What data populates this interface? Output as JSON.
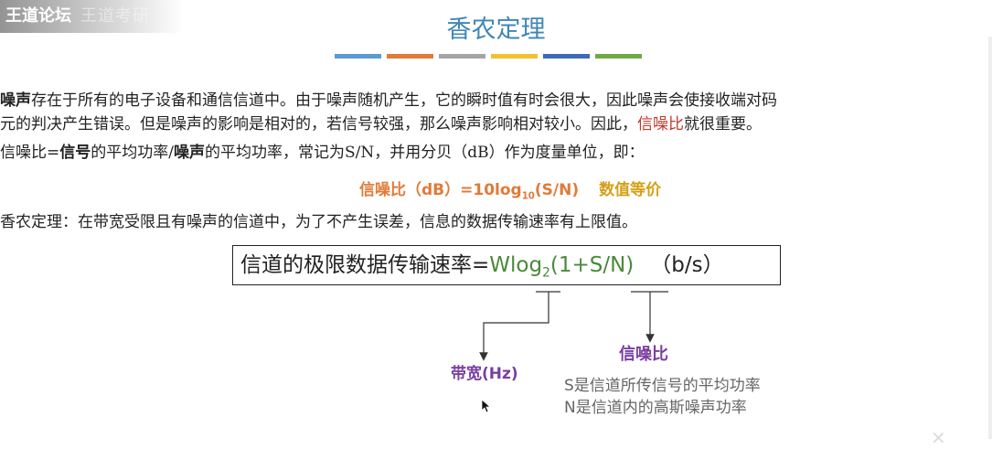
{
  "watermark": {
    "site": "王道论坛",
    "faded": "王道考研"
  },
  "title": "香农定理",
  "color_bars": [
    "#5b9bd5",
    "#e07b39",
    "#a5a5a5",
    "#f2c12e",
    "#3e6bb5",
    "#6fa945"
  ],
  "para1": {
    "term": "噪声",
    "line1_rest": "存在于所有的电子设备和通信信道中。由于噪声随机产生，它的瞬时值有时会很大，因此噪声会使接收端对码",
    "line2_pre": "元的判决产生错误。但是噪声的影响是相对的，若信号较强，那么噪声影响相对较小。因此，",
    "line2_red": "信噪比",
    "line2_post": "就很重要。"
  },
  "para2": {
    "pre": "信噪比=",
    "b1": "信号",
    "mid": "的平均功率/",
    "b2": "噪声",
    "post": "的平均功率，常记为S/N，并用分贝（dB）作为度量单位，即："
  },
  "formula_db": {
    "left": "信噪比（dB）=10log",
    "sub": "10",
    "right": "(S/N)",
    "note": "数值等价"
  },
  "para3": "香农定理：在带宽受限且有噪声的信道中，为了不产生误差，信息的数据传输速率有上限值。",
  "shannon": {
    "label": "信道的极限数据传输速率=",
    "w": "Wlog",
    "sub": "2",
    "expr": "(1+S/N)",
    "unit": "（b/s）"
  },
  "annotations": {
    "bandwidth": "带宽(Hz)",
    "snr": "信噪比",
    "s_def": "S是信道所传信号的平均功率",
    "n_def": "N是信道内的高斯噪声功率"
  }
}
